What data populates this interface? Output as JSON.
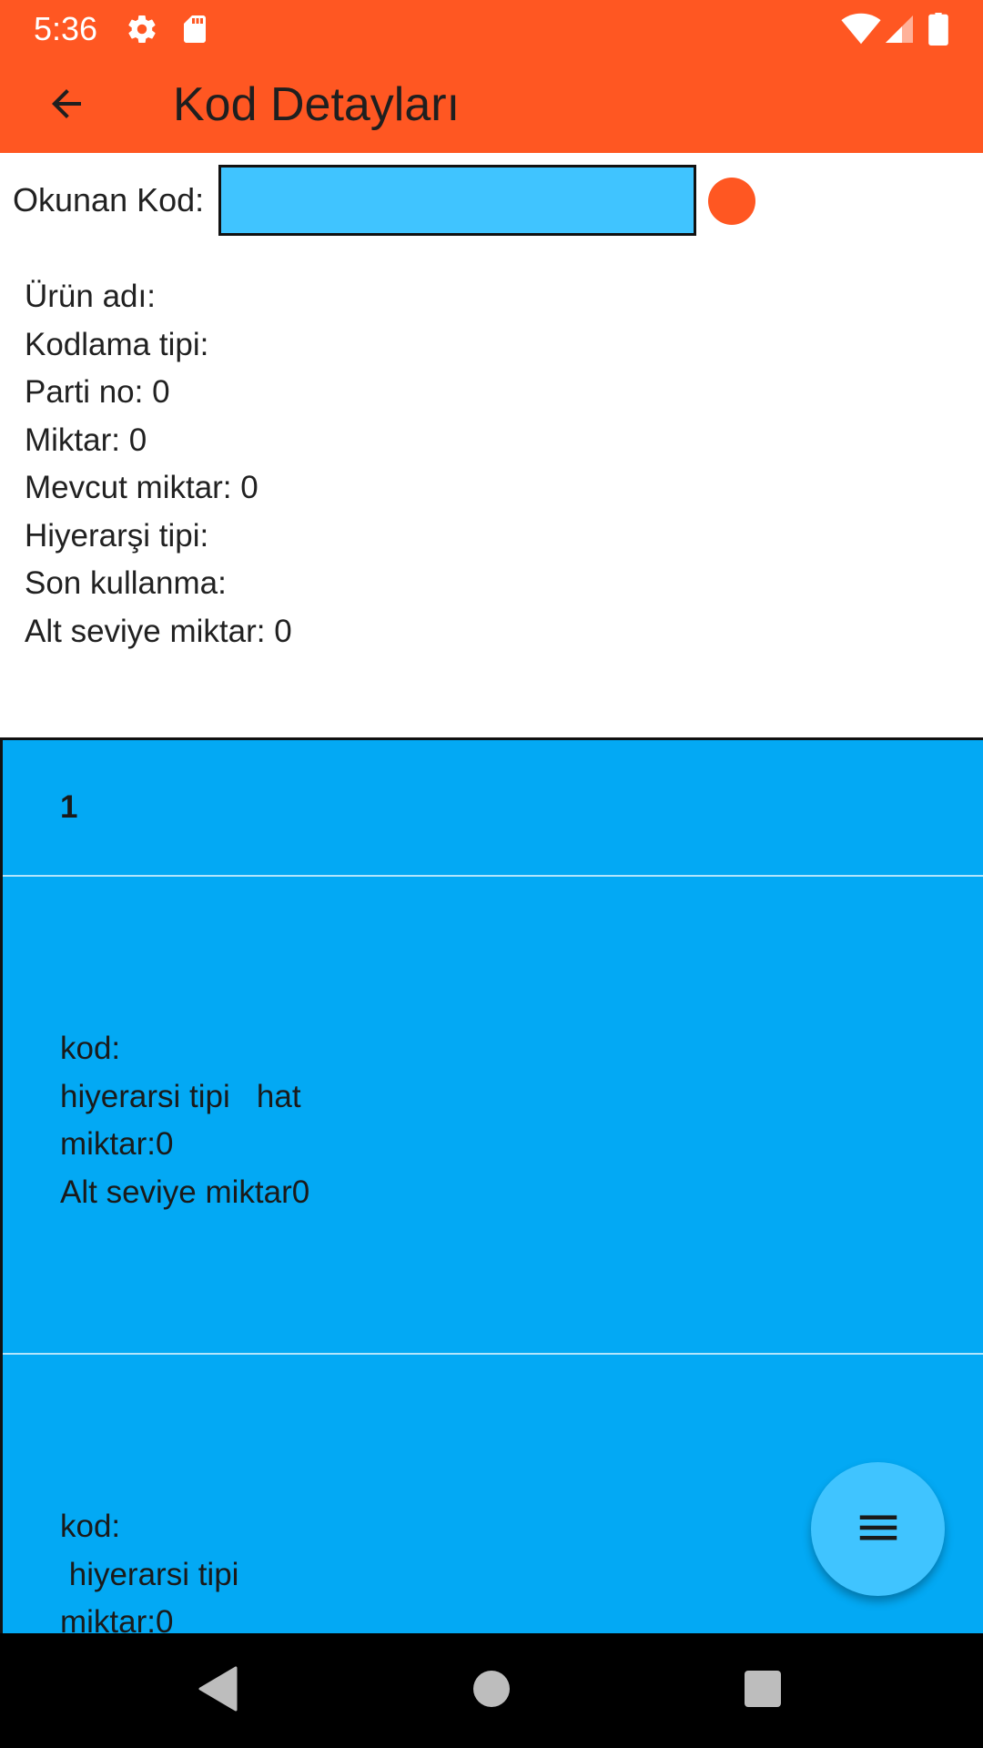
{
  "status_bar": {
    "time": "5:36",
    "icons": [
      "gear-icon",
      "sd-card-icon",
      "wifi-icon",
      "signal-icon",
      "battery-icon"
    ]
  },
  "app_bar": {
    "title": "Kod Detayları",
    "back_icon": "arrow-back-icon",
    "color": "#FF5722"
  },
  "scan": {
    "label": "Okunan Kod:",
    "value": "",
    "input_color": "#40C4FF",
    "indicator_color": "#FF5722"
  },
  "details": [
    "Ürün adı:",
    "Kodlama tipi:",
    "Parti no: 0",
    "Miktar: 0",
    "Mevcut miktar: 0",
    "Hiyerarşi tipi:",
    "Son kullanma:",
    "Alt seviye miktar: 0"
  ],
  "list": {
    "header": "1",
    "background": "#03A9F4",
    "items": [
      {
        "lines": [
          "kod:",
          "hiyerarsi tipi   hat",
          "miktar:0",
          "Alt seviye miktar0"
        ]
      },
      {
        "lines": [
          "kod:",
          " hiyerarsi tipi",
          "miktar:0"
        ]
      }
    ]
  },
  "fab": {
    "icon": "menu-icon",
    "color": "#40C4FF"
  },
  "nav_bar": {
    "buttons": [
      "back-triangle-icon",
      "home-circle-icon",
      "recents-square-icon"
    ]
  }
}
